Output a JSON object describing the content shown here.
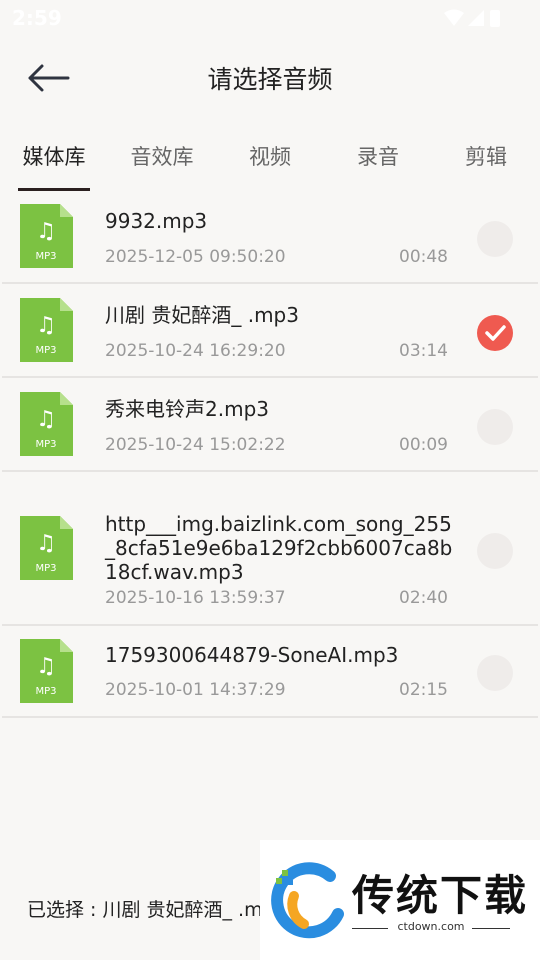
{
  "status_bar": {
    "time": "2:59"
  },
  "header": {
    "title": "请选择音频"
  },
  "tabs": [
    {
      "label": "媒体库",
      "active": true
    },
    {
      "label": "音效库",
      "active": false
    },
    {
      "label": "视频",
      "active": false
    },
    {
      "label": "录音",
      "active": false
    },
    {
      "label": "剪辑",
      "active": false
    }
  ],
  "files": [
    {
      "name": "9932.mp3",
      "date": "2025-12-05 09:50:20",
      "duration": "00:48",
      "selected": false,
      "icon_label": "MP3"
    },
    {
      "name": "川剧 贵妃醉酒_ .mp3",
      "date": "2025-10-24 16:29:20",
      "duration": "03:14",
      "selected": true,
      "icon_label": "MP3"
    },
    {
      "name": "秀来电铃声2.mp3",
      "date": "2025-10-24 15:02:22",
      "duration": "00:09",
      "selected": false,
      "icon_label": "MP3"
    },
    {
      "name": "http___img.baizlink.com_song_255_8cfa51e9e6ba129f2cbb6007ca8b18cf.wav.mp3",
      "date": "2025-10-16 13:59:37",
      "duration": "02:40",
      "selected": false,
      "icon_label": "MP3"
    },
    {
      "name": "1759300644879-SoneAI.mp3",
      "date": "2025-10-01 14:37:29",
      "duration": "02:15",
      "selected": false,
      "icon_label": "MP3"
    }
  ],
  "footer": {
    "selected_text": "已选择 : 川剧 贵妃醉酒_ .m"
  },
  "watermark": {
    "text": "传统下载",
    "url": "ctdown.com"
  },
  "colors": {
    "accent": "#ef5a50",
    "icon_green": "#7cc242",
    "text_dark": "#222222",
    "text_muted": "#999999"
  }
}
